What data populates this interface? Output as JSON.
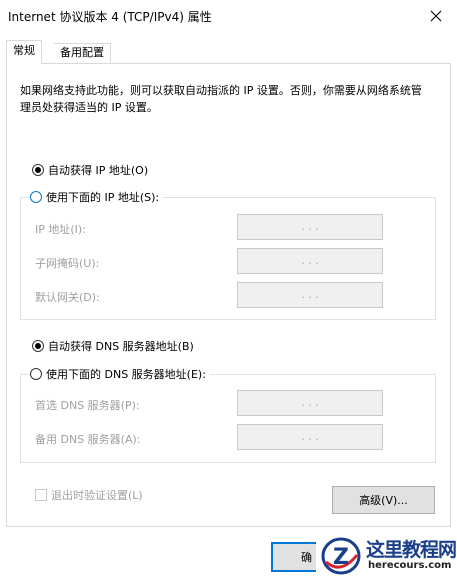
{
  "window": {
    "title": "Internet 协议版本 4 (TCP/IPv4) 属性"
  },
  "tabs": [
    {
      "label": "常规",
      "selected": true
    },
    {
      "label": "备用配置",
      "selected": false
    }
  ],
  "general": {
    "description": "如果网络支持此功能，则可以获取自动指派的 IP 设置。否则，你需要从网络系统管理员处获得适当的 IP 设置。",
    "ip_auto_label": "自动获得 IP 地址(O)",
    "ip_manual_label": "使用下面的 IP 地址(S):",
    "ip_mode": "auto",
    "ip_fields": [
      {
        "label": "IP 地址(I):",
        "value": ". . ."
      },
      {
        "label": "子网掩码(U):",
        "value": ". . ."
      },
      {
        "label": "默认网关(D):",
        "value": ". . ."
      }
    ],
    "dns_auto_label": "自动获得 DNS 服务器地址(B)",
    "dns_manual_label": "使用下面的 DNS 服务器地址(E):",
    "dns_mode": "auto",
    "dns_fields": [
      {
        "label": "首选 DNS 服务器(P):",
        "value": ". . ."
      },
      {
        "label": "备用 DNS 服务器(A):",
        "value": ". . ."
      }
    ],
    "validate_on_exit_label": "退出时验证设置(L)",
    "validate_on_exit_checked": false,
    "advanced_button_label": "高级(V)..."
  },
  "footer": {
    "ok_button_label": "确"
  },
  "watermark": {
    "title": "这里教程网",
    "url": "herecours.com",
    "logo_letter": "Z"
  },
  "colors": {
    "accent": "#0078d7",
    "disabled_text": "#a0a0a0",
    "watermark_blue": "#1a3e8c",
    "watermark_red": "#d9232d"
  }
}
